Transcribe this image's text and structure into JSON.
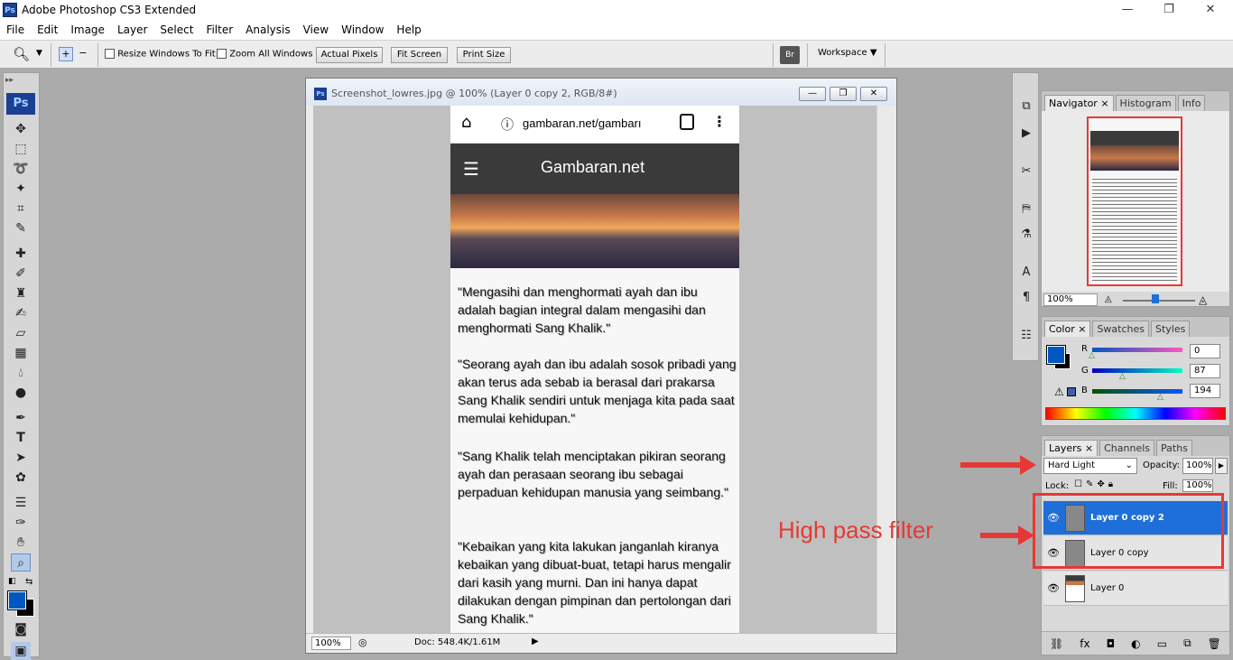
{
  "app": {
    "title": "Adobe Photoshop CS3 Extended",
    "logo_text": "Ps",
    "window_controls": {
      "minimize": "—",
      "maximize": "❐",
      "close": "✕"
    }
  },
  "menu": [
    "File",
    "Edit",
    "Image",
    "Layer",
    "Select",
    "Filter",
    "Analysis",
    "View",
    "Window",
    "Help"
  ],
  "options_bar": {
    "resize_windows_label": "Resize Windows To Fit",
    "zoom_all_label": "Zoom All Windows",
    "actual_pixels": "Actual Pixels",
    "fit_screen": "Fit Screen",
    "print_size": "Print Size",
    "workspace": "Workspace ▼"
  },
  "toolbox": {
    "logo": "Ps"
  },
  "document": {
    "title": "Screenshot_lowres.jpg @ 100% (Layer 0 copy 2, RGB/8#)",
    "zoom": "100%",
    "doc_size": "Doc: 548.4K/1.61M",
    "phone": {
      "url": "gambaran.net/gambarı",
      "site_title": "Gambaran.net",
      "paragraphs": [
        "\"Mengasihi dan menghormati ayah dan ibu adalah bagian integral dalam mengasihi dan menghormati Sang Khalik.\"",
        "\"Seorang ayah dan ibu adalah sosok pribadi yang akan terus ada sebab ia berasal dari prakarsa Sang Khalik sendiri untuk menjaga kita pada saat memulai kehidupan.\"",
        "\"Sang Khalik telah menciptakan pikiran seorang ayah dan perasaan seorang ibu sebagai perpaduan kehidupan manusia yang seimbang.\"",
        "\"Kebaikan yang kita lakukan janganlah kiranya kebaikan yang dibuat-buat, tetapi harus mengalir dari kasih yang murni. Dan ini hanya dapat dilakukan dengan pimpinan dan pertolongan dari Sang Khalik.\""
      ]
    }
  },
  "navigator": {
    "tabs": [
      "Navigator ×",
      "Histogram",
      "Info"
    ],
    "zoom": "100%"
  },
  "color": {
    "tabs": [
      "Color ×",
      "Swatches",
      "Styles"
    ],
    "channels": [
      {
        "label": "R",
        "value": "0"
      },
      {
        "label": "G",
        "value": "87"
      },
      {
        "label": "B",
        "value": "194"
      }
    ],
    "foreground_color": "#0057c2"
  },
  "layers": {
    "tabs": [
      "Layers ×",
      "Channels",
      "Paths"
    ],
    "blend_mode": "Hard Light",
    "opacity_label": "Opacity:",
    "opacity": "100%",
    "lock_label": "Lock:",
    "fill_label": "Fill:",
    "fill": "100%",
    "items": [
      {
        "name": "Layer 0 copy 2",
        "selected": true
      },
      {
        "name": "Layer 0 copy",
        "selected": false
      },
      {
        "name": "Layer 0",
        "selected": false
      }
    ],
    "bottom_icons": [
      "link-icon",
      "fx-icon",
      "mask-icon",
      "adjustment-icon",
      "folder-icon",
      "new-layer-icon",
      "trash-icon"
    ]
  },
  "annotation": {
    "label": "High pass filter",
    "color": "#e53935"
  }
}
